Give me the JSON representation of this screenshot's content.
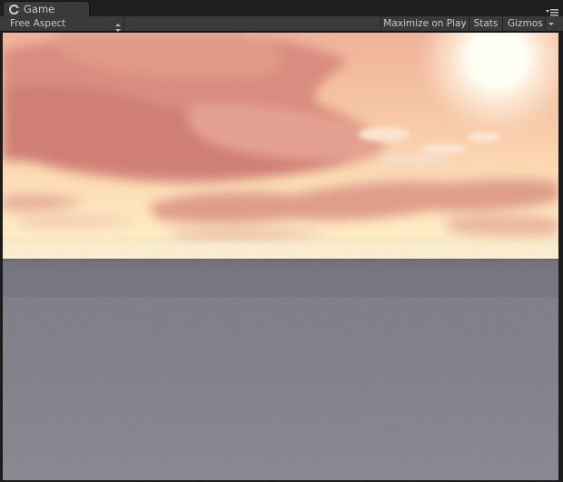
{
  "window": {
    "tab_label": "Game",
    "tab_icon": "game-controller-icon",
    "tab_menu_icon": "tab-menu-icon"
  },
  "toolbar": {
    "aspect_label": "Free Aspect",
    "aspect_icon": "dropdown-arrows-icon",
    "maximize_label": "Maximize on Play",
    "stats_label": "Stats",
    "gizmos_label": "Gizmos",
    "gizmos_arrow_icon": "chevron-down-icon"
  },
  "colors": {
    "editor_bg": "#1c1c1c",
    "toolbar_bg": "#3a3a3a",
    "text": "#c8c8c8",
    "sky_top": "#f1b49a",
    "sky_horizon": "#fff0c8",
    "sun": "#fffef0",
    "clouds": "#d98478",
    "ground": "#7f7c86"
  }
}
